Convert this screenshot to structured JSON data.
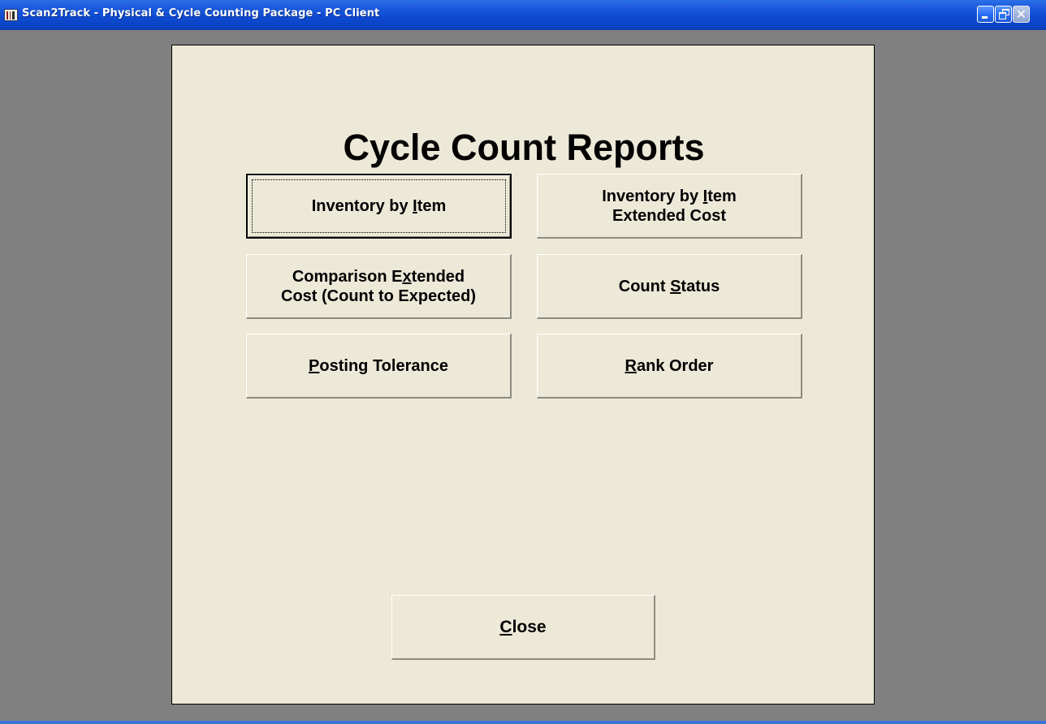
{
  "window": {
    "title": "Scan2Track - Physical & Cycle Counting Package - PC Client",
    "icon": "scan2track-app-icon",
    "controls": {
      "minimize": "minimize-icon",
      "restore": "restore-icon",
      "close": "close-icon"
    }
  },
  "panel": {
    "title": "Cycle Count Reports",
    "buttons": [
      {
        "id": "inventory-by-item",
        "line1_pre": "Inventory by ",
        "line1_ul": "I",
        "line1_post": "tem",
        "line2_pre": "",
        "line2_ul": "",
        "line2_post": "",
        "default": true
      },
      {
        "id": "inventory-by-item-extended-cost",
        "line1_pre": "Inventory by ",
        "line1_ul": "I",
        "line1_post": "tem",
        "line2_pre": "Extended Cost",
        "line2_ul": "",
        "line2_post": ""
      },
      {
        "id": "comparison-extended-cost",
        "line1_pre": "Comparison E",
        "line1_ul": "x",
        "line1_post": "tended",
        "line2_pre": "Cost (Count to Expected)",
        "line2_ul": "",
        "line2_post": ""
      },
      {
        "id": "count-status",
        "line1_pre": "Count ",
        "line1_ul": "S",
        "line1_post": "tatus",
        "line2_pre": "",
        "line2_ul": "",
        "line2_post": ""
      },
      {
        "id": "posting-tolerance",
        "line1_pre": "",
        "line1_ul": "P",
        "line1_post": "osting Tolerance",
        "line2_pre": "",
        "line2_ul": "",
        "line2_post": ""
      },
      {
        "id": "rank-order",
        "line1_pre": "",
        "line1_ul": "R",
        "line1_post": "ank Order",
        "line2_pre": "",
        "line2_ul": "",
        "line2_post": ""
      }
    ],
    "close": {
      "pre": "",
      "ul": "C",
      "post": "lose"
    }
  },
  "colors": {
    "titlebar": "#0a43c6",
    "desktop": "#808080",
    "panel": "#ece9d8",
    "text": "#000000"
  }
}
